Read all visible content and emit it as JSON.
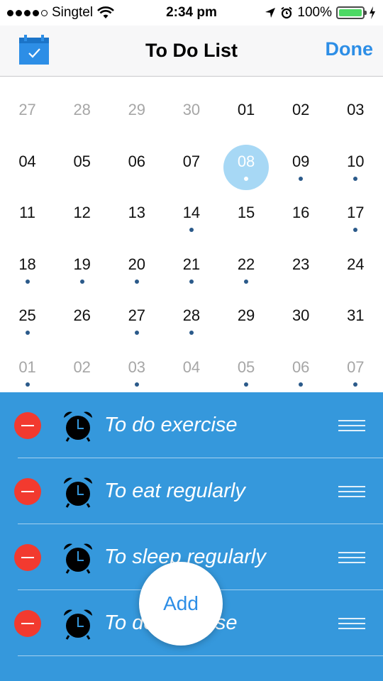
{
  "status_bar": {
    "carrier": "Singtel",
    "time": "2:34 pm",
    "battery": "100%",
    "battery_color": "#4cd964"
  },
  "nav": {
    "title": "To Do List",
    "done_label": "Done",
    "left_icon": "calendar-icon",
    "accent": "#2d8ee6"
  },
  "calendar": {
    "selected": "08",
    "days": [
      {
        "num": "27",
        "other": true,
        "dot": false
      },
      {
        "num": "28",
        "other": true,
        "dot": false
      },
      {
        "num": "29",
        "other": true,
        "dot": false
      },
      {
        "num": "30",
        "other": true,
        "dot": false
      },
      {
        "num": "01",
        "other": false,
        "dot": false
      },
      {
        "num": "02",
        "other": false,
        "dot": false
      },
      {
        "num": "03",
        "other": false,
        "dot": false
      },
      {
        "num": "04",
        "other": false,
        "dot": false
      },
      {
        "num": "05",
        "other": false,
        "dot": false
      },
      {
        "num": "06",
        "other": false,
        "dot": false
      },
      {
        "num": "07",
        "other": false,
        "dot": false
      },
      {
        "num": "08",
        "other": false,
        "dot": true,
        "selected": true
      },
      {
        "num": "09",
        "other": false,
        "dot": true
      },
      {
        "num": "10",
        "other": false,
        "dot": true
      },
      {
        "num": "11",
        "other": false,
        "dot": false
      },
      {
        "num": "12",
        "other": false,
        "dot": false
      },
      {
        "num": "13",
        "other": false,
        "dot": false
      },
      {
        "num": "14",
        "other": false,
        "dot": true
      },
      {
        "num": "15",
        "other": false,
        "dot": false
      },
      {
        "num": "16",
        "other": false,
        "dot": false
      },
      {
        "num": "17",
        "other": false,
        "dot": true
      },
      {
        "num": "18",
        "other": false,
        "dot": true
      },
      {
        "num": "19",
        "other": false,
        "dot": true
      },
      {
        "num": "20",
        "other": false,
        "dot": true
      },
      {
        "num": "21",
        "other": false,
        "dot": true
      },
      {
        "num": "22",
        "other": false,
        "dot": true
      },
      {
        "num": "23",
        "other": false,
        "dot": false
      },
      {
        "num": "24",
        "other": false,
        "dot": false
      },
      {
        "num": "25",
        "other": false,
        "dot": true
      },
      {
        "num": "26",
        "other": false,
        "dot": false
      },
      {
        "num": "27",
        "other": false,
        "dot": true
      },
      {
        "num": "28",
        "other": false,
        "dot": true
      },
      {
        "num": "29",
        "other": false,
        "dot": false
      },
      {
        "num": "30",
        "other": false,
        "dot": false
      },
      {
        "num": "31",
        "other": false,
        "dot": false
      },
      {
        "num": "01",
        "other": true,
        "dot": true
      },
      {
        "num": "02",
        "other": true,
        "dot": false
      },
      {
        "num": "03",
        "other": true,
        "dot": true
      },
      {
        "num": "04",
        "other": true,
        "dot": false
      },
      {
        "num": "05",
        "other": true,
        "dot": true
      },
      {
        "num": "06",
        "other": true,
        "dot": true
      },
      {
        "num": "07",
        "other": true,
        "dot": true
      }
    ]
  },
  "tasks": {
    "background": "#3598dc",
    "items": [
      {
        "text": "To do exercise"
      },
      {
        "text": "To eat regularly"
      },
      {
        "text": "To sleep regularly"
      },
      {
        "text": "To do exercise"
      }
    ]
  },
  "add_button": {
    "label": "Add"
  }
}
